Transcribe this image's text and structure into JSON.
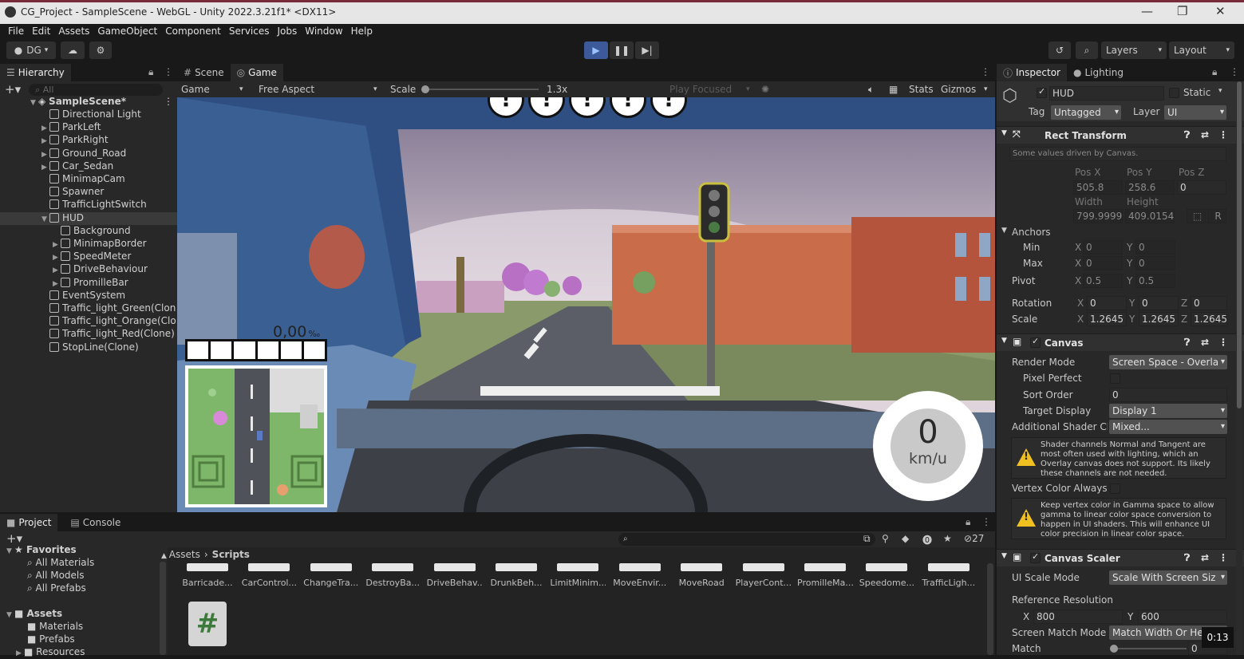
{
  "window": {
    "title": "CG_Project - SampleScene - WebGL - Unity 2022.3.21f1* <DX11>",
    "controls": [
      "—",
      "❐",
      "✕"
    ]
  },
  "menu": [
    "File",
    "Edit",
    "Assets",
    "GameObject",
    "Component",
    "Services",
    "Jobs",
    "Window",
    "Help"
  ],
  "toolbar": {
    "account": "DG",
    "layers": "Layers",
    "layout": "Layout"
  },
  "hierarchy": {
    "tab": "Hierarchy",
    "search_placeholder": "All",
    "scene": "SampleScene*",
    "items": [
      {
        "label": "Directional Light",
        "depth": 1,
        "arrow": false
      },
      {
        "label": "ParkLeft",
        "depth": 1,
        "arrow": true
      },
      {
        "label": "ParkRight",
        "depth": 1,
        "arrow": true
      },
      {
        "label": "Ground_Road",
        "depth": 1,
        "arrow": true
      },
      {
        "label": "Car_Sedan",
        "depth": 1,
        "arrow": true
      },
      {
        "label": "MinimapCam",
        "depth": 1,
        "arrow": false
      },
      {
        "label": "Spawner",
        "depth": 1,
        "arrow": false
      },
      {
        "label": "TrafficLightSwitch",
        "depth": 1,
        "arrow": false
      },
      {
        "label": "HUD",
        "depth": 1,
        "arrow": true,
        "selected": true
      },
      {
        "label": "Background",
        "depth": 2,
        "arrow": false
      },
      {
        "label": "MinimapBorder",
        "depth": 2,
        "arrow": true
      },
      {
        "label": "SpeedMeter",
        "depth": 2,
        "arrow": true
      },
      {
        "label": "DriveBehaviour",
        "depth": 2,
        "arrow": true
      },
      {
        "label": "PromilleBar",
        "depth": 2,
        "arrow": true
      },
      {
        "label": "EventSystem",
        "depth": 1,
        "arrow": false
      },
      {
        "label": "Traffic_light_Green(Clon",
        "depth": 1,
        "arrow": false
      },
      {
        "label": "Traffic_light_Orange(Clo",
        "depth": 1,
        "arrow": false
      },
      {
        "label": "Traffic_light_Red(Clone)",
        "depth": 1,
        "arrow": false
      },
      {
        "label": "StopLine(Clone)",
        "depth": 1,
        "arrow": false
      }
    ]
  },
  "game": {
    "tabs": {
      "scene": "Scene",
      "game": "Game"
    },
    "display": "Game",
    "aspect": "Free Aspect",
    "scale_label": "Scale",
    "scale_value": "1.3x",
    "play_focused": "Play Focused",
    "stats": "Stats",
    "gizmos": "Gizmos",
    "hud": {
      "promille": "0,00",
      "promille_unit": "‰",
      "speed": "0",
      "speed_unit": "km/u",
      "warnings": [
        "!",
        "!",
        "!",
        "!",
        "!"
      ]
    }
  },
  "inspector": {
    "tabs": {
      "inspector": "Inspector",
      "lighting": "Lighting"
    },
    "object_name": "HUD",
    "static_label": "Static",
    "tag_label": "Tag",
    "tag_value": "Untagged",
    "layer_label": "Layer",
    "layer_value": "UI",
    "rect": {
      "title": "Rect Transform",
      "note": "Some values driven by Canvas.",
      "pos_x_label": "Pos X",
      "pos_y_label": "Pos Y",
      "pos_z_label": "Pos Z",
      "pos_x": "505.8",
      "pos_y": "258.6",
      "pos_z": "0",
      "width_label": "Width",
      "height_label": "Height",
      "width": "799.9999",
      "height": "409.0154",
      "r_button": "R",
      "anchors": "Anchors",
      "min": "Min",
      "max": "Max",
      "pivot": "Pivot",
      "min_x": "0",
      "min_y": "0",
      "max_x": "0",
      "max_y": "0",
      "pivot_x": "0.5",
      "pivot_y": "0.5",
      "rotation": "Rotation",
      "rot_x": "0",
      "rot_y": "0",
      "rot_z": "0",
      "scale": "Scale",
      "scale_x": "1.2645",
      "scale_y": "1.2645",
      "scale_z": "1.2645"
    },
    "canvas": {
      "title": "Canvas",
      "render_mode_label": "Render Mode",
      "render_mode": "Screen Space - Overla",
      "pixel_perfect": "Pixel Perfect",
      "sort_order_label": "Sort Order",
      "sort_order": "0",
      "target_display_label": "Target Display",
      "target_display": "Display 1",
      "shader_label": "Additional Shader Ch",
      "shader_value": "Mixed...",
      "warn1": "Shader channels Normal and Tangent are most often used with lighting, which an Overlay canvas does not support. Its likely these channels are not needed.",
      "vertex_label": "Vertex Color Always",
      "warn2": "Keep vertex color in Gamma space to allow gamma to linear color space conversion to happen in UI shaders. This will enhance UI color precision in linear color space."
    },
    "scaler": {
      "title": "Canvas Scaler",
      "ui_scale_label": "UI Scale Mode",
      "ui_scale": "Scale With Screen Siz",
      "ref_label": "Reference Resolution",
      "ref_x": "800",
      "ref_y": "600",
      "match_mode_label": "Screen Match Mode",
      "match_mode": "Match Width Or Hei",
      "match_label": "Match",
      "match_value": "0"
    },
    "axis": {
      "x": "X",
      "y": "Y",
      "z": "Z"
    }
  },
  "project": {
    "tabs": {
      "project": "Project",
      "console": "Console"
    },
    "hidden_count": "27",
    "favorites": "Favorites",
    "fav_items": [
      "All Materials",
      "All Models",
      "All Prefabs"
    ],
    "assets_root": "Assets",
    "asset_folders": [
      "Materials",
      "Prefabs",
      "Resources"
    ],
    "breadcrumb": [
      "Assets",
      "Scripts"
    ],
    "scripts": [
      "Barricade...",
      "CarControl...",
      "ChangeTra...",
      "DestroyBa...",
      "DriveBehav...",
      "DrunkBeh...",
      "LimitMinim...",
      "MoveEnvir...",
      "MoveRoad",
      "PlayerCont...",
      "PromilleMa...",
      "Speedome...",
      "TrafficLigh..."
    ],
    "cs_glyph": "#"
  },
  "overlay_time": "0:13",
  "colors": {
    "accent": "#3c5a99",
    "sky": "#c7b5c8",
    "road": "#5b5e66"
  }
}
